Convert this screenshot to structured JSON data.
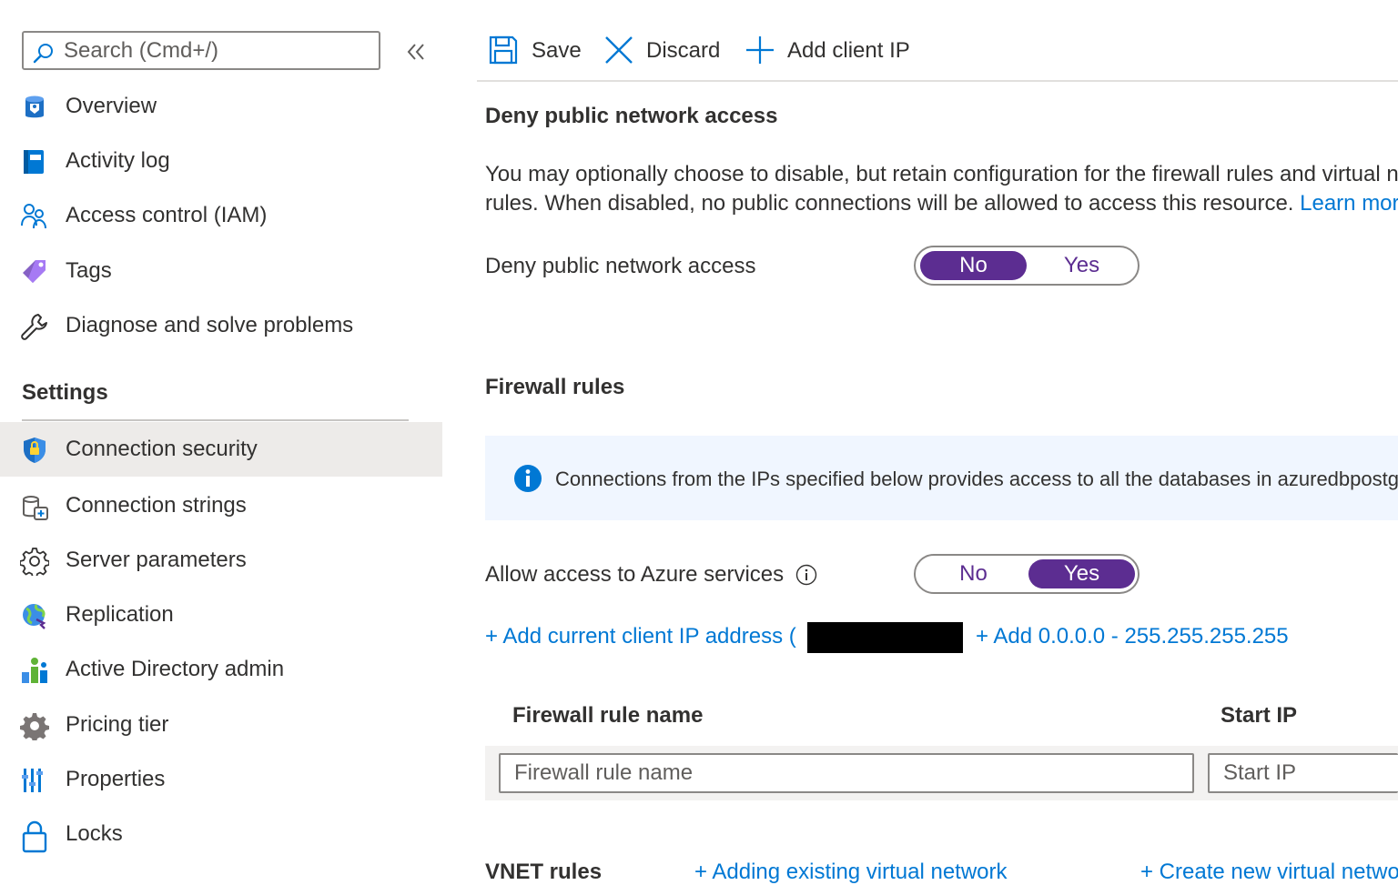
{
  "sidebar": {
    "search_placeholder": "Search (Cmd+/)",
    "items_top": [
      {
        "label": "Overview",
        "icon": "database-icon"
      },
      {
        "label": "Activity log",
        "icon": "activity-log-icon"
      },
      {
        "label": "Access control (IAM)",
        "icon": "people-icon"
      },
      {
        "label": "Tags",
        "icon": "tag-icon"
      },
      {
        "label": "Diagnose and solve problems",
        "icon": "wrench-icon"
      }
    ],
    "settings_title": "Settings",
    "items_settings": [
      {
        "label": "Connection security",
        "icon": "shield-icon",
        "active": true
      },
      {
        "label": "Connection strings",
        "icon": "connection-strings-icon"
      },
      {
        "label": "Server parameters",
        "icon": "gear-icon"
      },
      {
        "label": "Replication",
        "icon": "globe-icon"
      },
      {
        "label": "Active Directory admin",
        "icon": "directory-icon"
      },
      {
        "label": "Pricing tier",
        "icon": "pricing-gear-icon"
      },
      {
        "label": "Properties",
        "icon": "properties-icon"
      },
      {
        "label": "Locks",
        "icon": "lock-icon"
      }
    ]
  },
  "toolbar": {
    "save_label": "Save",
    "discard_label": "Discard",
    "add_client_ip_label": "Add client IP"
  },
  "deny_section": {
    "title": "Deny public network access",
    "description": "You may optionally choose to disable, but retain configuration for the firewall rules and virtual network rules. When disabled, no public connections will be allowed to access this resource.",
    "learn_more": "Learn more",
    "field_label": "Deny public network access",
    "toggle": {
      "no": "No",
      "yes": "Yes",
      "selected": "No"
    }
  },
  "firewall_section": {
    "title": "Firewall rules",
    "info_text": "Connections from the IPs specified below provides access to all the databases in azuredbpostgres.",
    "azure_services_label": "Allow access to Azure services",
    "azure_toggle": {
      "no": "No",
      "yes": "Yes",
      "selected": "Yes"
    },
    "add_current_ip": "+ Add current client IP address (",
    "add_all_range": "+ Add 0.0.0.0 - 255.255.255.255",
    "table": {
      "col_name": "Firewall rule name",
      "col_start": "Start IP",
      "name_placeholder": "Firewall rule name",
      "start_placeholder": "Start IP"
    }
  },
  "vnet_section": {
    "title": "VNET rules",
    "add_existing": "+ Adding existing virtual network",
    "create_new": "+ Create new virtual network"
  },
  "colors": {
    "accent_purple": "#5c2d91",
    "link_blue": "#0078d4",
    "info_bg": "#f0f6ff"
  }
}
